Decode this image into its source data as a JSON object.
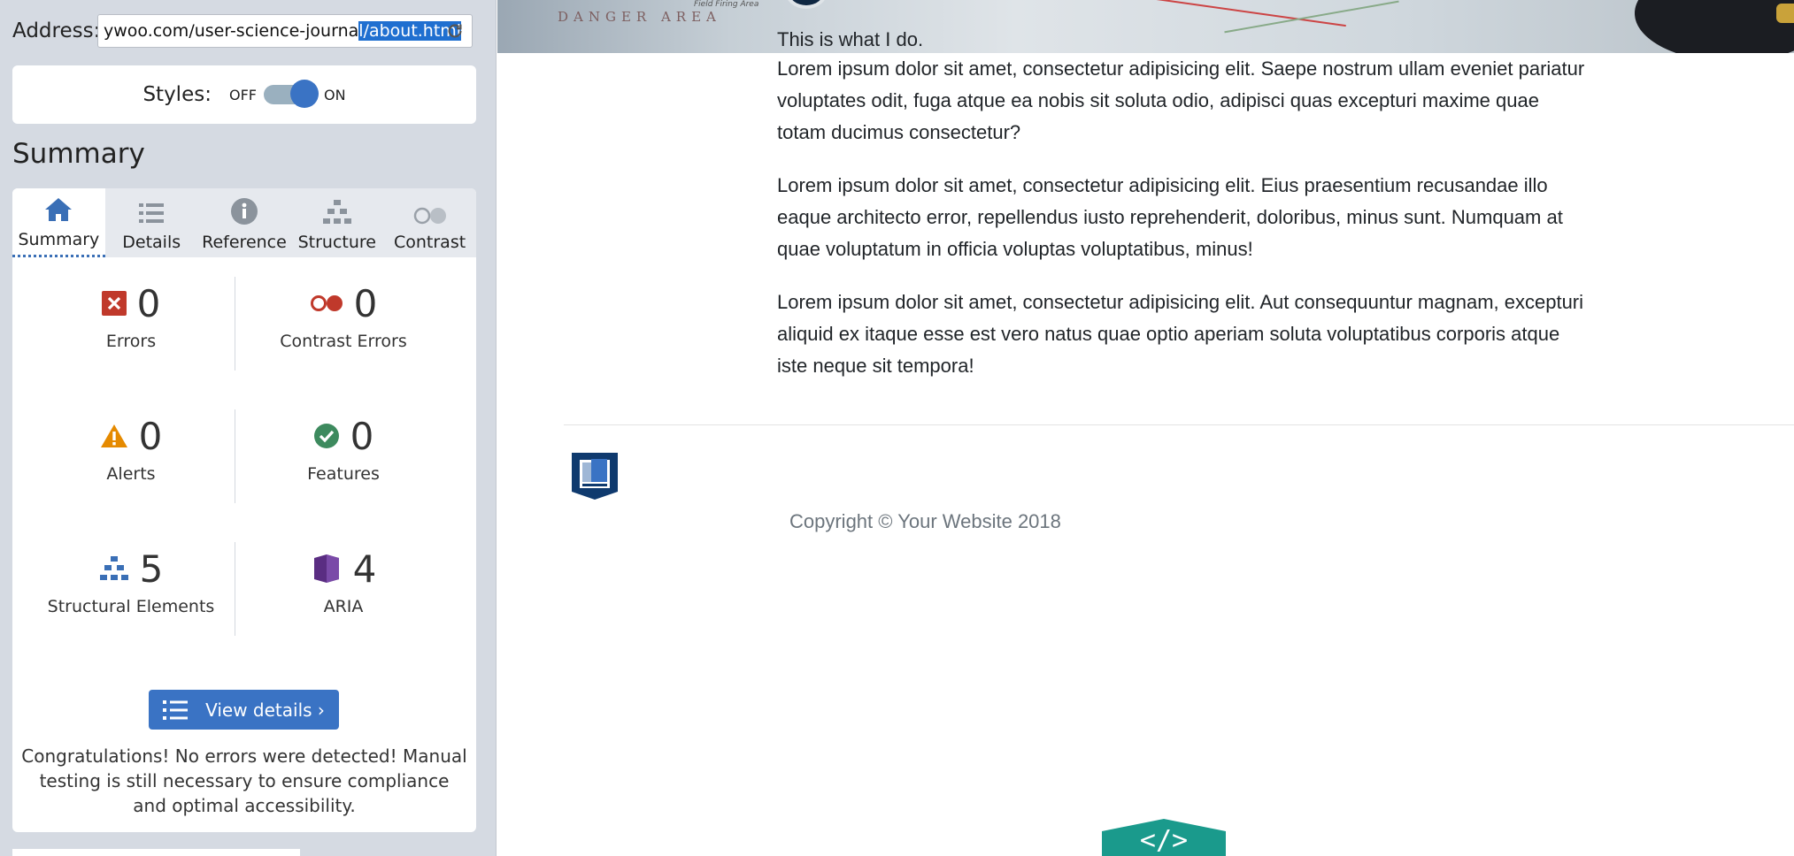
{
  "address": {
    "label": "Address:",
    "url_prefix": "ywoo.com/user-science-journa",
    "url_selected": "l/about.html"
  },
  "styles": {
    "label": "Styles:",
    "off_label": "OFF",
    "on_label": "ON",
    "state": "on"
  },
  "summary_title": "Summary",
  "tabs": [
    {
      "label": "Summary",
      "icon": "home-icon",
      "active": true
    },
    {
      "label": "Details",
      "icon": "list-icon",
      "active": false
    },
    {
      "label": "Reference",
      "icon": "info-icon",
      "active": false
    },
    {
      "label": "Structure",
      "icon": "hierarchy-icon",
      "active": false
    },
    {
      "label": "Contrast",
      "icon": "contrast-icon",
      "active": false
    }
  ],
  "stats": {
    "errors": {
      "value": "0",
      "label": "Errors",
      "icon": "error-x-icon"
    },
    "contrast_errors": {
      "value": "0",
      "label": "Contrast Errors",
      "icon": "contrast-error-icon"
    },
    "alerts": {
      "value": "0",
      "label": "Alerts",
      "icon": "alert-triangle-icon"
    },
    "features": {
      "value": "0",
      "label": "Features",
      "icon": "check-circle-icon"
    },
    "structural": {
      "value": "5",
      "label": "Structural Elements",
      "icon": "hierarchy-icon"
    },
    "aria": {
      "value": "4",
      "label": "ARIA",
      "icon": "aria-cube-icon"
    }
  },
  "view_details_label": "View details ›",
  "congrats": "Congratulations! No errors were detected! Manual testing is still necessary to ensure compliance and optimal accessibility.",
  "page": {
    "intro": "This is what I do.",
    "paragraphs": [
      "Lorem ipsum dolor sit amet, consectetur adipisicing elit. Saepe nostrum ullam eveniet pariatur voluptates odit, fuga atque ea nobis sit soluta odio, adipisci quas excepturi maxime quae totam ducimus consectetur?",
      "Lorem ipsum dolor sit amet, consectetur adipisicing elit. Eius praesentium recusandae illo eaque architecto error, repellendus iusto reprehenderit, doloribus, minus sunt. Numquam at quae voluptatum in officia voluptas voluptatibus, minus!",
      "Lorem ipsum dolor sit amet, consectetur adipisicing elit. Aut consequuntur magnam, excepturi aliquid ex itaque esse est vero natus quae optio aperiam soluta voluptatibus corporis atque iste neque sit tempora!"
    ],
    "copyright": "Copyright © Your Website 2018",
    "banner_text": "DANGER AREA",
    "banner_small": "Field Firing Area",
    "code_badge": "</>"
  },
  "colors": {
    "sidebar_bg": "#d5dae2",
    "accent_blue": "#3a73c4",
    "error_red": "#c0392b",
    "alert_orange": "#e58a00",
    "feature_green": "#3d8a5e",
    "aria_purple": "#5a2d82",
    "badge_teal": "#1a9a8c"
  }
}
